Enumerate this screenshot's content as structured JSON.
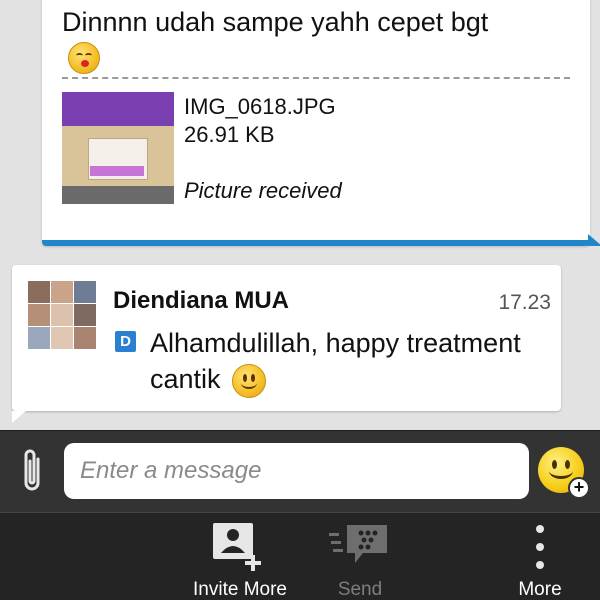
{
  "conversation": {
    "outgoing": {
      "text": "Dinnnn udah sampe yahh cepet bgt",
      "emoji": "kissing-face-icon",
      "attachment": {
        "file_name": "IMG_0618.JPG",
        "file_size": "26.91 KB",
        "status": "Picture received"
      },
      "accent_color": "#1f86c9"
    },
    "incoming": {
      "sender": "Diendiana MUA",
      "time": "17.23",
      "badge": "D",
      "text": "Alhamdulillah, happy treatment cantik",
      "emoji": "smiling-face-icon"
    }
  },
  "compose": {
    "placeholder": "Enter a message",
    "attach_icon": "paperclip-icon",
    "emoticon_icon": "smiley-add-icon"
  },
  "action_bar": {
    "invite_label": "Invite More",
    "send_label": "Send",
    "more_label": "More"
  },
  "colors": {
    "background": "#e2e2e2",
    "bar": "#333333",
    "badge": "#2b7fd1"
  }
}
